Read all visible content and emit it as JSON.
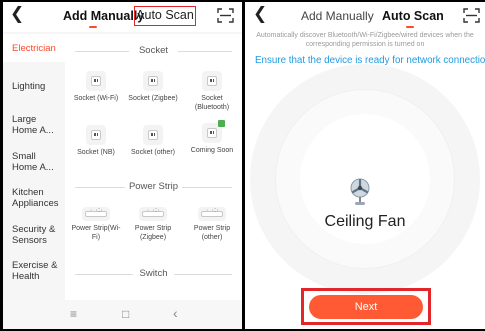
{
  "left_screen": {
    "tabs": {
      "add_manually": "Add Manually",
      "auto_scan": "Auto Scan"
    },
    "sidebar": [
      {
        "label": "Electrician",
        "active": true
      },
      {
        "label": "Lighting"
      },
      {
        "label": "Large Home A..."
      },
      {
        "label": "Small Home A..."
      },
      {
        "label": "Kitchen Appliances"
      },
      {
        "label": "Security & Sensors"
      },
      {
        "label": "Exercise & Health"
      }
    ],
    "sections": [
      {
        "title": "Socket",
        "devices": [
          "Socket (Wi-Fi)",
          "Socket (Zigbee)",
          "Socket (Bluetooth)",
          "Socket (NB)",
          "Socket (other)",
          "Coming Soon"
        ]
      },
      {
        "title": "Power Strip",
        "devices": [
          "Power Strip(Wi-Fi)",
          "Power Strip (Zigbee)",
          "Power Strip (other)"
        ]
      },
      {
        "title": "Switch",
        "devices": []
      }
    ],
    "navbar": {
      "menu_icon": "≡",
      "home_icon": "□",
      "back_icon": "‹"
    }
  },
  "right_screen": {
    "tabs": {
      "add_manually": "Add Manually",
      "auto_scan": "Auto Scan"
    },
    "hint": "Automatically discover Bluetooth/Wi-Fi/Zigbee/wired devices when the corresponding permission is turned on",
    "ready_text": "Ensure that the device is ready for network connection.",
    "device_name": "Ceiling Fan",
    "next_label": "Next"
  },
  "colors": {
    "accent": "#ff4a2a",
    "highlight_box": "#e3262a",
    "link_blue": "#1e9be0",
    "next_button": "#ff5a33"
  }
}
